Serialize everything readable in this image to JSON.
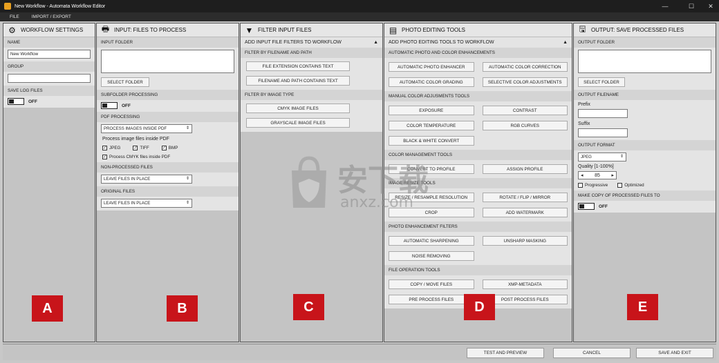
{
  "window": {
    "title": "New Workflow - Automata Workflow Editor",
    "min": "—",
    "max": "☐",
    "close": "✕"
  },
  "menu": {
    "file": "FILE",
    "import_export": "IMPORT / EXPORT"
  },
  "workflow": {
    "title": "WORKFLOW SETTINGS",
    "name_label": "NAME",
    "name_value": "New Workflow",
    "group_label": "GROUP",
    "group_value": "",
    "savelog_label": "SAVE LOG FILES",
    "savelog_state": "OFF",
    "marker": "A"
  },
  "input": {
    "title": "INPUT: FILES TO PROCESS",
    "folder_label": "INPUT FOLDER",
    "select_folder": "SELECT FOLDER",
    "subfolder_label": "SUBFOLDER PROCESSING",
    "subfolder_state": "OFF",
    "pdf_label": "PDF PROCESSING",
    "pdf_select": "PROCESS IMAGES INSIDE PDF",
    "pdf_inside": "Process image files inside PDF",
    "cb_jpeg": "JPEG",
    "cb_tiff": "TIFF",
    "cb_bmp": "BMP",
    "cb_cmyk": "Process CMYK files inside PDF",
    "nonprocessed_label": "NON-PROCESSED FILES",
    "nonprocessed_select": "LEAVE FILES IN PLACE",
    "original_label": "ORIGINAL FILES",
    "original_select": "LEAVE FILES IN PLACE",
    "marker": "B"
  },
  "filter": {
    "title": "FILTER INPUT FILES",
    "add_label": "ADD INPUT FILE FILTERS TO WORKFLOW",
    "by_name_label": "FILTER BY FILENAME AND PATH",
    "ext_btn": "FILE EXTENSION CONTAINS TEXT",
    "path_btn": "FILENAME AND PATH CONTAINS TEXT",
    "by_type_label": "FILTER BY IMAGE TYPE",
    "cmyk_btn": "CMYK IMAGE FILES",
    "gray_btn": "GRAYSCALE IMAGE FILES",
    "marker": "C"
  },
  "tools": {
    "title": "PHOTO EDITING TOOLS",
    "add_label": "ADD PHOTO EDITING TOOLS TO WORKFLOW",
    "auto_label": "AUTOMATIC PHOTO AND COLOR ENHANCEMENTS",
    "auto_btns": [
      "AUTOMATIC PHOTO ENHANCER",
      "AUTOMATIC COLOR CORRECTION",
      "AUTOMATIC COLOR GRADING",
      "SELECTIVE COLOR ADJUSTMENTS"
    ],
    "manual_label": "MANUAL COLOR ADJUSMENTS TOOLS",
    "manual_btns": [
      "EXPOSURE",
      "CONTRAST",
      "COLOR TEMPERATURE",
      "RGB CURVES",
      "BLACK & WHITE CONVERT"
    ],
    "colormgmt_label": "COLOR MANAGEMENT TOOLS",
    "colormgmt_btns": [
      "CONVERT TO PROFILE",
      "ASSIGN PROFILE"
    ],
    "resize_label": "IMAGE RESIZE TOOLS",
    "resize_btns": [
      "RESIZE / RESAMPLE RESOLUTION",
      "ROTATE / FLIP / MIRROR",
      "CROP",
      "ADD WATERMARK"
    ],
    "enh_label": "PHOTO ENHANCEMENT FILTERS",
    "enh_btns": [
      "AUTOMATIC SHARPENING",
      "UNSHARP MASKING",
      "NOISE REMOVING"
    ],
    "fileop_label": "FILE OPERATION TOOLS",
    "fileop_btns": [
      "COPY / MOVE FILES",
      "XMP-METADATA",
      "PRE PROCESS FILES",
      "POST PROCESS FILES"
    ],
    "marker": "D"
  },
  "output": {
    "title": "OUTPUT: SAVE PROCESSED FILES",
    "folder_label": "OUTPUT FOLDER",
    "select_folder": "SELECT FOLDER",
    "filename_label": "OUTPUT FILENAME",
    "prefix_label": "Prefix",
    "suffix_label": "Suffix",
    "format_label": "OUTPUT FORMAT",
    "format_value": "JPEG",
    "quality_label": "Quality [1-100%]",
    "quality_value": "85",
    "progressive": "Progressive",
    "optimized": "Optimized",
    "copy_label": "MAKE COPY OF PROCESSED FILES TO",
    "copy_state": "OFF",
    "marker": "E"
  },
  "footer": {
    "test": "TEST AND PREVIEW",
    "cancel": "CANCEL",
    "save": "SAVE AND EXIT"
  },
  "watermark": {
    "cn": "安下载",
    "en": "anxz.com"
  }
}
